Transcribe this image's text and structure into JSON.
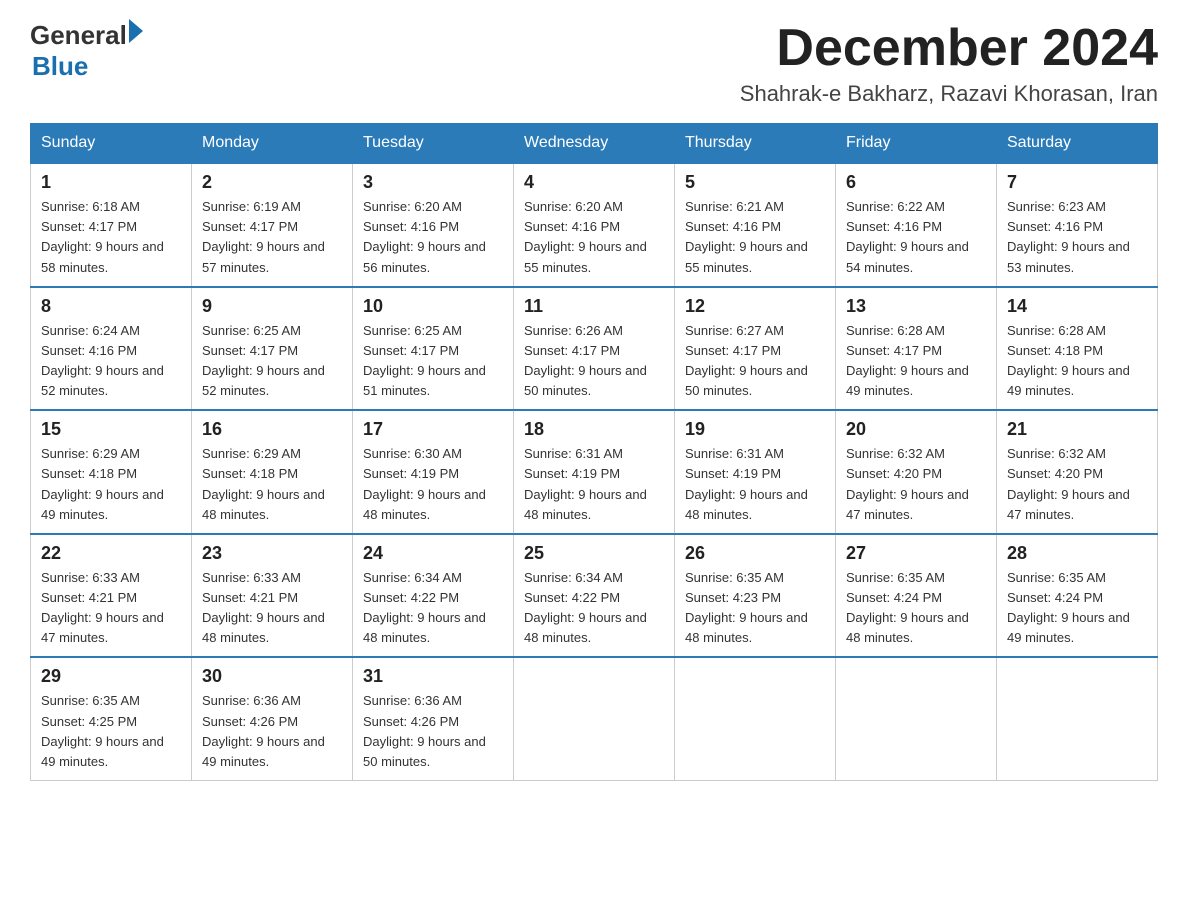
{
  "logo": {
    "general": "General",
    "blue": "Blue",
    "triangle": "▶"
  },
  "header": {
    "month": "December 2024",
    "location": "Shahrak-e Bakharz, Razavi Khorasan, Iran"
  },
  "weekdays": [
    "Sunday",
    "Monday",
    "Tuesday",
    "Wednesday",
    "Thursday",
    "Friday",
    "Saturday"
  ],
  "weeks": [
    [
      {
        "day": "1",
        "sunrise": "6:18 AM",
        "sunset": "4:17 PM",
        "daylight": "9 hours and 58 minutes."
      },
      {
        "day": "2",
        "sunrise": "6:19 AM",
        "sunset": "4:17 PM",
        "daylight": "9 hours and 57 minutes."
      },
      {
        "day": "3",
        "sunrise": "6:20 AM",
        "sunset": "4:16 PM",
        "daylight": "9 hours and 56 minutes."
      },
      {
        "day": "4",
        "sunrise": "6:20 AM",
        "sunset": "4:16 PM",
        "daylight": "9 hours and 55 minutes."
      },
      {
        "day": "5",
        "sunrise": "6:21 AM",
        "sunset": "4:16 PM",
        "daylight": "9 hours and 55 minutes."
      },
      {
        "day": "6",
        "sunrise": "6:22 AM",
        "sunset": "4:16 PM",
        "daylight": "9 hours and 54 minutes."
      },
      {
        "day": "7",
        "sunrise": "6:23 AM",
        "sunset": "4:16 PM",
        "daylight": "9 hours and 53 minutes."
      }
    ],
    [
      {
        "day": "8",
        "sunrise": "6:24 AM",
        "sunset": "4:16 PM",
        "daylight": "9 hours and 52 minutes."
      },
      {
        "day": "9",
        "sunrise": "6:25 AM",
        "sunset": "4:17 PM",
        "daylight": "9 hours and 52 minutes."
      },
      {
        "day": "10",
        "sunrise": "6:25 AM",
        "sunset": "4:17 PM",
        "daylight": "9 hours and 51 minutes."
      },
      {
        "day": "11",
        "sunrise": "6:26 AM",
        "sunset": "4:17 PM",
        "daylight": "9 hours and 50 minutes."
      },
      {
        "day": "12",
        "sunrise": "6:27 AM",
        "sunset": "4:17 PM",
        "daylight": "9 hours and 50 minutes."
      },
      {
        "day": "13",
        "sunrise": "6:28 AM",
        "sunset": "4:17 PM",
        "daylight": "9 hours and 49 minutes."
      },
      {
        "day": "14",
        "sunrise": "6:28 AM",
        "sunset": "4:18 PM",
        "daylight": "9 hours and 49 minutes."
      }
    ],
    [
      {
        "day": "15",
        "sunrise": "6:29 AM",
        "sunset": "4:18 PM",
        "daylight": "9 hours and 49 minutes."
      },
      {
        "day": "16",
        "sunrise": "6:29 AM",
        "sunset": "4:18 PM",
        "daylight": "9 hours and 48 minutes."
      },
      {
        "day": "17",
        "sunrise": "6:30 AM",
        "sunset": "4:19 PM",
        "daylight": "9 hours and 48 minutes."
      },
      {
        "day": "18",
        "sunrise": "6:31 AM",
        "sunset": "4:19 PM",
        "daylight": "9 hours and 48 minutes."
      },
      {
        "day": "19",
        "sunrise": "6:31 AM",
        "sunset": "4:19 PM",
        "daylight": "9 hours and 48 minutes."
      },
      {
        "day": "20",
        "sunrise": "6:32 AM",
        "sunset": "4:20 PM",
        "daylight": "9 hours and 47 minutes."
      },
      {
        "day": "21",
        "sunrise": "6:32 AM",
        "sunset": "4:20 PM",
        "daylight": "9 hours and 47 minutes."
      }
    ],
    [
      {
        "day": "22",
        "sunrise": "6:33 AM",
        "sunset": "4:21 PM",
        "daylight": "9 hours and 47 minutes."
      },
      {
        "day": "23",
        "sunrise": "6:33 AM",
        "sunset": "4:21 PM",
        "daylight": "9 hours and 48 minutes."
      },
      {
        "day": "24",
        "sunrise": "6:34 AM",
        "sunset": "4:22 PM",
        "daylight": "9 hours and 48 minutes."
      },
      {
        "day": "25",
        "sunrise": "6:34 AM",
        "sunset": "4:22 PM",
        "daylight": "9 hours and 48 minutes."
      },
      {
        "day": "26",
        "sunrise": "6:35 AM",
        "sunset": "4:23 PM",
        "daylight": "9 hours and 48 minutes."
      },
      {
        "day": "27",
        "sunrise": "6:35 AM",
        "sunset": "4:24 PM",
        "daylight": "9 hours and 48 minutes."
      },
      {
        "day": "28",
        "sunrise": "6:35 AM",
        "sunset": "4:24 PM",
        "daylight": "9 hours and 49 minutes."
      }
    ],
    [
      {
        "day": "29",
        "sunrise": "6:35 AM",
        "sunset": "4:25 PM",
        "daylight": "9 hours and 49 minutes."
      },
      {
        "day": "30",
        "sunrise": "6:36 AM",
        "sunset": "4:26 PM",
        "daylight": "9 hours and 49 minutes."
      },
      {
        "day": "31",
        "sunrise": "6:36 AM",
        "sunset": "4:26 PM",
        "daylight": "9 hours and 50 minutes."
      },
      null,
      null,
      null,
      null
    ]
  ]
}
